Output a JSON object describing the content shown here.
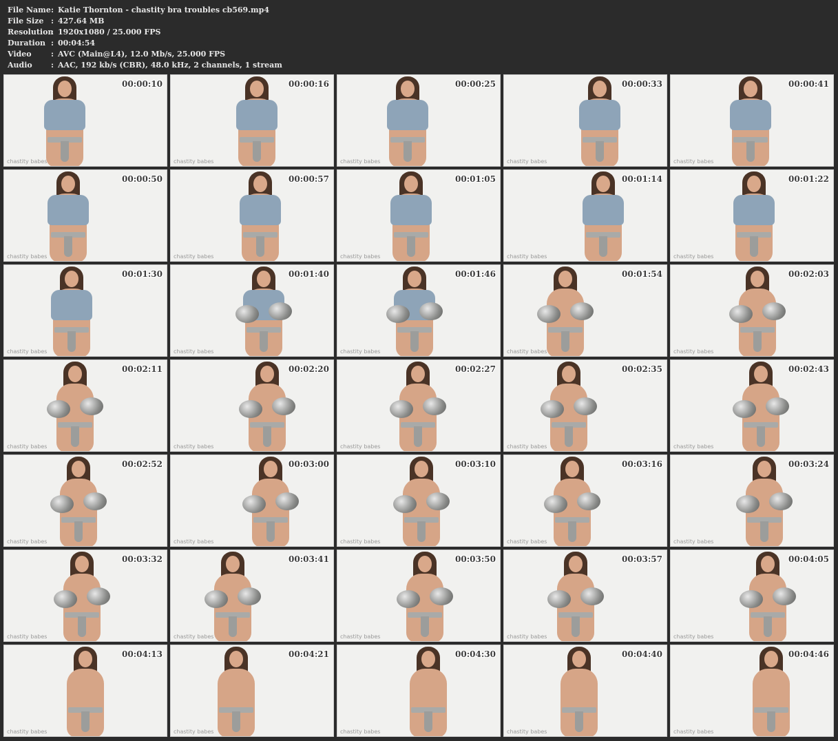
{
  "info": [
    {
      "key": "File Name",
      "sep": ":",
      "value": "Katie Thornton - chastity bra troubles cb569.mp4"
    },
    {
      "key": "File Size",
      "sep": ":",
      "value": "427.64 MB"
    },
    {
      "key": "Resolution",
      "sep": ":",
      "value": "1920x1080 / 25.000 FPS"
    },
    {
      "key": "Duration",
      "sep": ":",
      "value": "00:04:54"
    },
    {
      "key": "Video",
      "sep": ":",
      "value": "AVC (Main@L4), 12.0 Mb/s, 25.000 FPS"
    },
    {
      "key": "Audio",
      "sep": ":",
      "value": "AAC, 192 kb/s (CBR), 48.0 kHz, 2 channels, 1 stream"
    }
  ],
  "watermark_logo": "chastity babes",
  "thumbnails": [
    {
      "timestamp": "00:00:10",
      "vest": true,
      "steel": false
    },
    {
      "timestamp": "00:00:16",
      "vest": true,
      "steel": false
    },
    {
      "timestamp": "00:00:25",
      "vest": true,
      "steel": false
    },
    {
      "timestamp": "00:00:33",
      "vest": true,
      "steel": false
    },
    {
      "timestamp": "00:00:41",
      "vest": true,
      "steel": false
    },
    {
      "timestamp": "00:00:50",
      "vest": true,
      "steel": false
    },
    {
      "timestamp": "00:00:57",
      "vest": true,
      "steel": false
    },
    {
      "timestamp": "00:01:05",
      "vest": true,
      "steel": false
    },
    {
      "timestamp": "00:01:14",
      "vest": true,
      "steel": false
    },
    {
      "timestamp": "00:01:22",
      "vest": true,
      "steel": false
    },
    {
      "timestamp": "00:01:30",
      "vest": true,
      "steel": false
    },
    {
      "timestamp": "00:01:40",
      "vest": true,
      "steel": true
    },
    {
      "timestamp": "00:01:46",
      "vest": true,
      "steel": true
    },
    {
      "timestamp": "00:01:54",
      "vest": false,
      "steel": true
    },
    {
      "timestamp": "00:02:03",
      "vest": false,
      "steel": true
    },
    {
      "timestamp": "00:02:11",
      "vest": false,
      "steel": true
    },
    {
      "timestamp": "00:02:20",
      "vest": false,
      "steel": true
    },
    {
      "timestamp": "00:02:27",
      "vest": false,
      "steel": true
    },
    {
      "timestamp": "00:02:35",
      "vest": false,
      "steel": true
    },
    {
      "timestamp": "00:02:43",
      "vest": false,
      "steel": true
    },
    {
      "timestamp": "00:02:52",
      "vest": false,
      "steel": true
    },
    {
      "timestamp": "00:03:00",
      "vest": false,
      "steel": true
    },
    {
      "timestamp": "00:03:10",
      "vest": false,
      "steel": true
    },
    {
      "timestamp": "00:03:16",
      "vest": false,
      "steel": true
    },
    {
      "timestamp": "00:03:24",
      "vest": false,
      "steel": true
    },
    {
      "timestamp": "00:03:32",
      "vest": false,
      "steel": true
    },
    {
      "timestamp": "00:03:41",
      "vest": false,
      "steel": true
    },
    {
      "timestamp": "00:03:50",
      "vest": false,
      "steel": true
    },
    {
      "timestamp": "00:03:57",
      "vest": false,
      "steel": true
    },
    {
      "timestamp": "00:04:05",
      "vest": false,
      "steel": true
    },
    {
      "timestamp": "00:04:13",
      "vest": false,
      "steel": false
    },
    {
      "timestamp": "00:04:21",
      "vest": false,
      "steel": false
    },
    {
      "timestamp": "00:04:30",
      "vest": false,
      "steel": false
    },
    {
      "timestamp": "00:04:40",
      "vest": false,
      "steel": false
    },
    {
      "timestamp": "00:04:46",
      "vest": false,
      "steel": false
    }
  ]
}
